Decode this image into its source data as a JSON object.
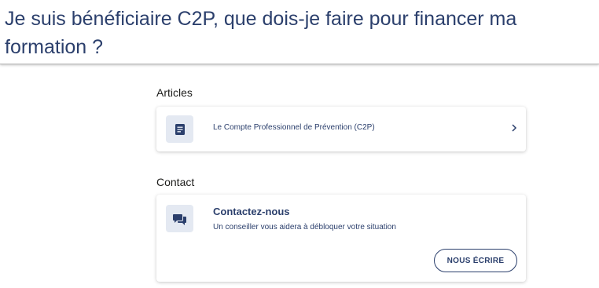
{
  "header": {
    "title": "Je suis bénéficiaire C2P, que dois-je faire pour financer ma formation ?"
  },
  "articles": {
    "section_title": "Articles",
    "items": [
      {
        "label": "Le Compte Professionnel de Prévention (C2P)",
        "icon": "document-icon"
      }
    ]
  },
  "contact": {
    "section_title": "Contact",
    "card": {
      "icon": "chat-icon",
      "title": "Contactez-nous",
      "description": "Un conseiller vous aidera à débloquer votre situation",
      "button_label": "NOUS ÉCRIRE"
    }
  },
  "colors": {
    "primary": "#2b3f6c",
    "icon_background": "#e4e9f2",
    "text": "#1d1d1b"
  }
}
